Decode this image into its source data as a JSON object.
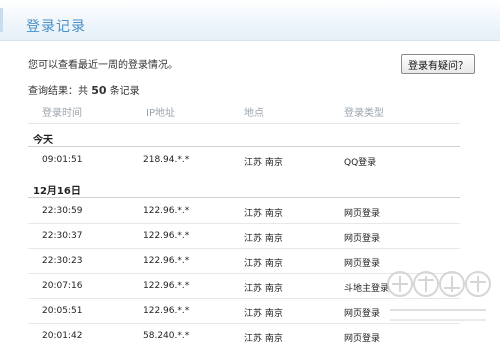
{
  "header": {
    "title": "登录记录"
  },
  "intro": "您可以查看最近一周的登录情况。",
  "question_button": "登录有疑问？",
  "result": {
    "prefix": "查询结果：共",
    "count": "50",
    "suffix": "条记录"
  },
  "columns": [
    "登录时间",
    "IP地址",
    "地点",
    "登录类型"
  ],
  "groups": [
    {
      "label": "今天",
      "rows": [
        {
          "time": "09:01:51",
          "ip": "218.94.*.*",
          "location": "江苏 南京",
          "type": "QQ登录"
        }
      ]
    },
    {
      "label": "12月16日",
      "rows": [
        {
          "time": "22:30:59",
          "ip": "122.96.*.*",
          "location": "江苏 南京",
          "type": "网页登录"
        },
        {
          "time": "22:30:37",
          "ip": "122.96.*.*",
          "location": "江苏 南京",
          "type": "网页登录"
        },
        {
          "time": "22:30:23",
          "ip": "122.96.*.*",
          "location": "江苏 南京",
          "type": "网页登录"
        },
        {
          "time": "20:07:16",
          "ip": "122.96.*.*",
          "location": "江苏 南京",
          "type": "斗地主登录"
        },
        {
          "time": "20:05:51",
          "ip": "122.96.*.*",
          "location": "江苏 南京",
          "type": "网页登录"
        },
        {
          "time": "20:01:42",
          "ip": "58.240.*.*",
          "location": "江苏 南京",
          "type": "网页登录"
        }
      ]
    }
  ],
  "colors": {
    "title": "#4a90c8",
    "header_bg": "#eef5fb",
    "column_head": "#9aa4ad"
  }
}
